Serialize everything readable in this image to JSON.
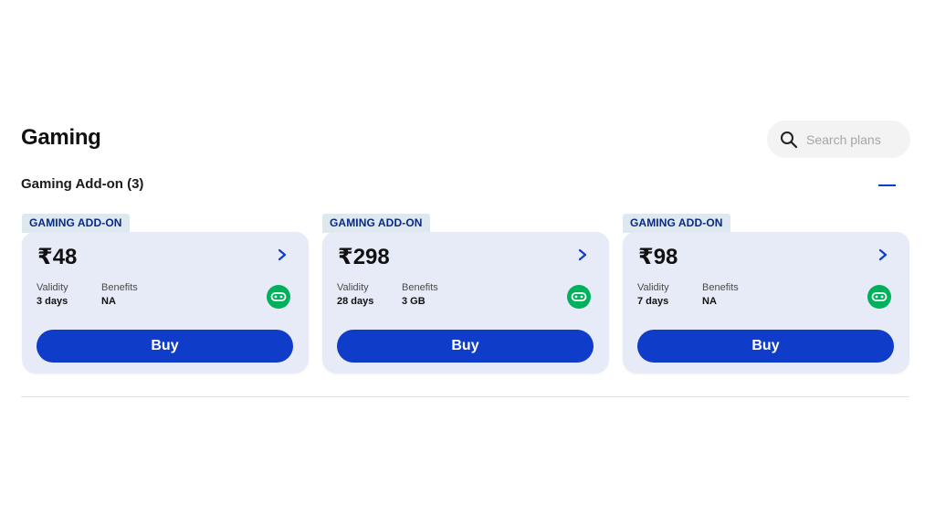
{
  "page": {
    "title": "Gaming"
  },
  "search": {
    "placeholder": "Search plans"
  },
  "section": {
    "title": "Gaming Add-on (3)"
  },
  "colors": {
    "brand": "#0f3cc9",
    "card_bg": "#e7ebf7",
    "tag_bg": "#dde8ef",
    "game_icon": "#00b15b"
  },
  "plans": [
    {
      "tag": "GAMING ADD-ON",
      "price": "₹48",
      "validity_label": "Validity",
      "validity": "3 days",
      "benefits_label": "Benefits",
      "benefits": "NA",
      "benefit_icon": "gamepad-icon",
      "buy_label": "Buy"
    },
    {
      "tag": "GAMING ADD-ON",
      "price": "₹298",
      "validity_label": "Validity",
      "validity": "28 days",
      "benefits_label": "Benefits",
      "benefits": "3 GB",
      "benefit_icon": "gamepad-icon",
      "buy_label": "Buy"
    },
    {
      "tag": "GAMING ADD-ON",
      "price": "₹98",
      "validity_label": "Validity",
      "validity": "7 days",
      "benefits_label": "Benefits",
      "benefits": "NA",
      "benefit_icon": "gamepad-icon",
      "buy_label": "Buy"
    }
  ]
}
